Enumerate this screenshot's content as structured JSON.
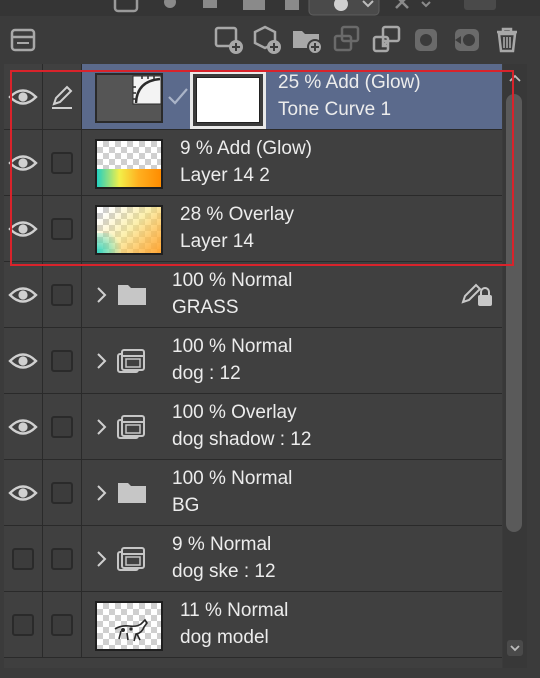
{
  "toolbar": {
    "icons": [
      "layer-properties-icon",
      "new-raster-layer-icon",
      "new-vector-layer-icon",
      "new-folder-icon",
      "transfer-down-icon",
      "combine-layers-icon",
      "create-mask-icon",
      "apply-mask-icon",
      "delete-layer-icon"
    ]
  },
  "layers": [
    {
      "opacity_mode": "25 %  Add (Glow)",
      "name": "Tone Curve 1",
      "visible": true,
      "selected": true,
      "type": "correction"
    },
    {
      "opacity_mode": "9 %  Add (Glow)",
      "name": "Layer 14 2",
      "visible": true,
      "selected": false,
      "type": "raster"
    },
    {
      "opacity_mode": "28 %  Overlay",
      "name": "Layer 14",
      "visible": true,
      "selected": false,
      "type": "raster"
    },
    {
      "opacity_mode": "100 %  Normal",
      "name": "GRASS",
      "visible": true,
      "selected": false,
      "type": "folder",
      "locked": true
    },
    {
      "opacity_mode": "100 %  Normal",
      "name": "dog : 12",
      "visible": true,
      "selected": false,
      "type": "animation-folder"
    },
    {
      "opacity_mode": "100 %  Overlay",
      "name": "dog shadow : 12",
      "visible": true,
      "selected": false,
      "type": "animation-folder"
    },
    {
      "opacity_mode": "100 %  Normal",
      "name": "BG",
      "visible": true,
      "selected": false,
      "type": "folder"
    },
    {
      "opacity_mode": "9 %  Normal",
      "name": "dog ske : 12",
      "visible": false,
      "selected": false,
      "type": "animation-folder"
    },
    {
      "opacity_mode": "11 %  Normal",
      "name": "dog model",
      "visible": false,
      "selected": false,
      "type": "raster"
    }
  ],
  "colors": {
    "selected_row": "#5b6a8c",
    "highlight": "#d9232b",
    "panel_bg": "#3b3b3b"
  }
}
